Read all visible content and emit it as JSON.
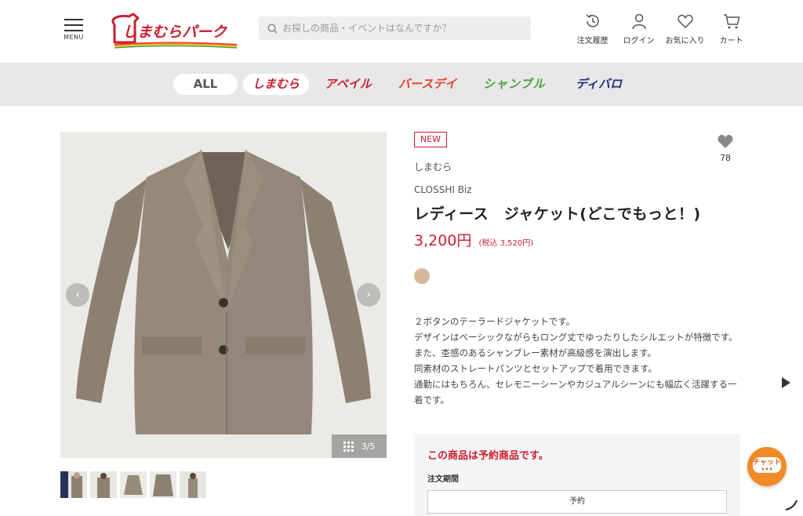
{
  "header": {
    "menu_label": "MENU",
    "logo_text": "しまむらパーク",
    "search_placeholder": "お探しの商品・イベントはなんですか？",
    "icons": [
      {
        "label": "注文履歴",
        "icon": "history-icon"
      },
      {
        "label": "ログイン",
        "icon": "user-icon"
      },
      {
        "label": "お気に入り",
        "icon": "heart-icon"
      },
      {
        "label": "カート",
        "icon": "cart-icon"
      }
    ]
  },
  "brand_nav": {
    "items": [
      "ALL",
      "しまむら",
      "アベイル",
      "バースデイ",
      "シャンブル",
      "ディバロ"
    ],
    "selected": "しまむら",
    "colors": {
      "shimamura": "#cc1d2e",
      "avail": "#cc1d2e",
      "birthday": "#e8402a",
      "shanple": "#4ba33b",
      "divalo": "#1e2a7a"
    }
  },
  "gallery": {
    "counter": "3/5",
    "thumbnail_count": 5,
    "image_description_icon": "jacket-image"
  },
  "product": {
    "badge": "NEW",
    "favorite_count": "78",
    "brand": "しまむら",
    "sub_brand": "CLOSSHI Biz",
    "title": "レディース　ジャケット(どこでもっと！)",
    "price": "3,200円",
    "price_tax": "(税込 3,520円)",
    "swatch_color": "#d6b99d",
    "description": [
      "２ボタンのテーラードジャケットです。",
      "デザインはベーシックながらもロング丈でゆったりしたシルエットが特徴です。",
      "また、杢感のあるシャンブレー素材が高級感を演出します。",
      "同素材のストレートパンツとセットアップで着用できます。",
      "通勤にはもちろん、セレモニーシーンやカジュアルシーンにも幅広く活躍する一着です。"
    ]
  },
  "preorder": {
    "heading": "この商品は予約商品です。",
    "period_label": "注文期間",
    "reserve_label": "予約"
  },
  "floating": {
    "chat_label": "チャット",
    "chat_dots": "•••"
  },
  "colors": {
    "accent": "#cc1d2e",
    "nav_bg": "#e8e8e8",
    "chat": "#f08a25"
  }
}
